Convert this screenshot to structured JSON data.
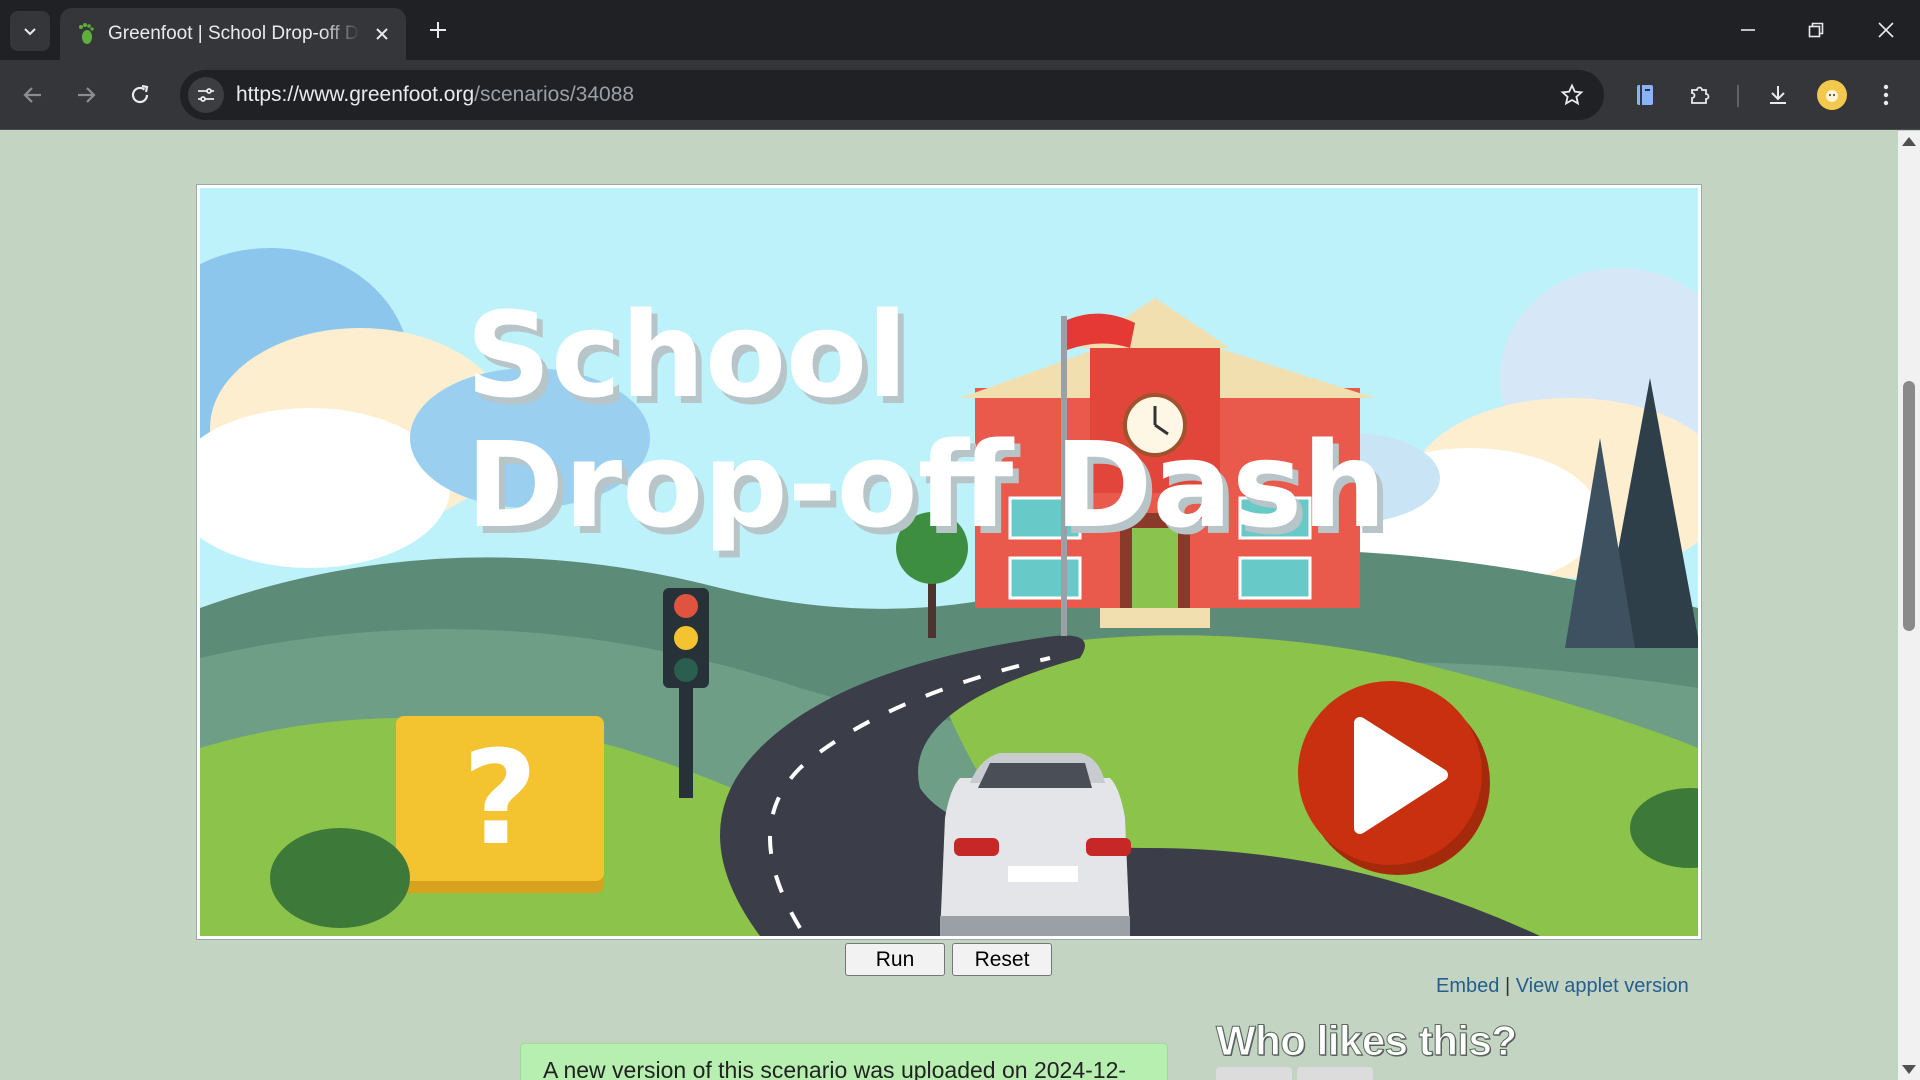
{
  "browser": {
    "tab": {
      "title": "Greenfoot | School Drop-off Dash",
      "favicon": "greenfoot-footprint-icon"
    },
    "url": {
      "host": "https://www.greenfoot.org",
      "path": "/scenarios/34088"
    },
    "icons": [
      "tab-list-icon",
      "close-icon",
      "plus-icon",
      "minimize-icon",
      "restore-icon",
      "close-window-icon",
      "back-icon",
      "forward-icon",
      "reload-icon",
      "site-info-icon",
      "star-icon",
      "reading-list-icon",
      "extensions-icon",
      "download-icon",
      "profile-icon",
      "menu-icon"
    ]
  },
  "game": {
    "title_line1": "School",
    "title_line2": "Drop-off Dash",
    "help_symbol": "?",
    "colors": {
      "sky": "#bdf2fb",
      "school": "#ea5a4c",
      "roof": "#f2dfb0",
      "play": "#c9300f",
      "help": "#f3c42f",
      "grass": "#8cc34a"
    }
  },
  "controls": {
    "run_label": "Run",
    "reset_label": "Reset"
  },
  "links": {
    "embed": "Embed",
    "separator": "|",
    "applet": "View applet version"
  },
  "notice": {
    "text": "A new version of this scenario was uploaded on 2024-12-"
  },
  "sidebar": {
    "who_likes": "Who likes this?"
  }
}
